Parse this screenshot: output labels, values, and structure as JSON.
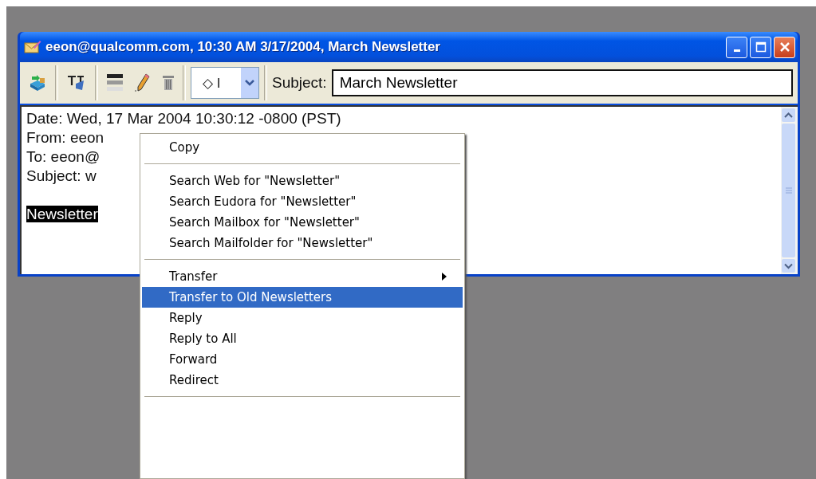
{
  "window": {
    "title": "eeon@qualcomm.com, 10:30 AM 3/17/2004, March Newsletter"
  },
  "toolbar": {
    "label_dropdown": {
      "value": "◇ I"
    },
    "subject": {
      "label": "Subject:",
      "value": "March Newsletter"
    }
  },
  "message": {
    "lines": [
      {
        "kind": "text",
        "text": "Date: Wed, 17 Mar 2004 10:30:12 -0800 (PST)",
        "selected": false
      },
      {
        "kind": "text",
        "text": "From: eeon",
        "selected": false
      },
      {
        "kind": "text",
        "text": "To: eeon@",
        "selected": false
      },
      {
        "kind": "text",
        "text": "Subject: w",
        "selected": false
      },
      {
        "kind": "blank"
      },
      {
        "kind": "text",
        "text": "Newsletter",
        "selected": true
      }
    ]
  },
  "context_menu": {
    "items": [
      {
        "kind": "item",
        "label": "Copy",
        "selected": false,
        "submenu": false
      },
      {
        "kind": "separator"
      },
      {
        "kind": "item",
        "label": "Search Web for \"Newsletter\"",
        "selected": false,
        "submenu": false
      },
      {
        "kind": "item",
        "label": "Search Eudora for \"Newsletter\"",
        "selected": false,
        "submenu": false
      },
      {
        "kind": "item",
        "label": "Search Mailbox for \"Newsletter\"",
        "selected": false,
        "submenu": false
      },
      {
        "kind": "item",
        "label": "Search Mailfolder for \"Newsletter\"",
        "selected": false,
        "submenu": false
      },
      {
        "kind": "separator"
      },
      {
        "kind": "item",
        "label": "Transfer",
        "selected": false,
        "submenu": true
      },
      {
        "kind": "item",
        "label": "Transfer to Old Newsletters",
        "selected": true,
        "submenu": false
      },
      {
        "kind": "item",
        "label": "Reply",
        "selected": false,
        "submenu": false
      },
      {
        "kind": "item",
        "label": "Reply to All",
        "selected": false,
        "submenu": false
      },
      {
        "kind": "item",
        "label": "Forward",
        "selected": false,
        "submenu": false
      },
      {
        "kind": "item",
        "label": "Redirect",
        "selected": false,
        "submenu": false
      },
      {
        "kind": "separator"
      }
    ]
  }
}
